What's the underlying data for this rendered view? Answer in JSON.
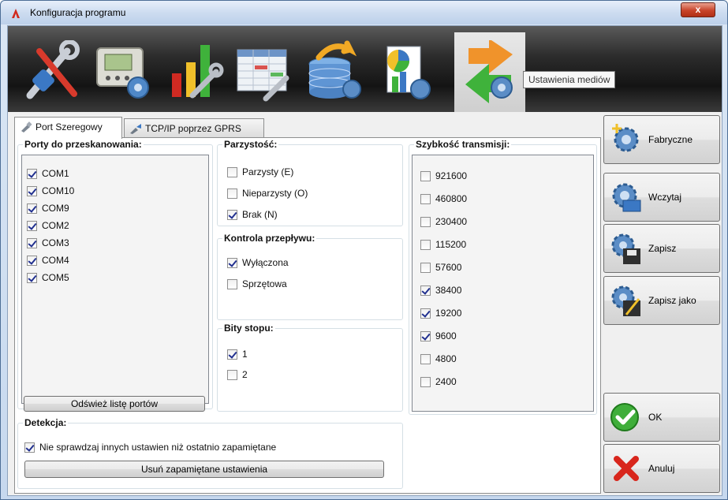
{
  "window": {
    "title": "Konfiguracja programu",
    "close_label": "x"
  },
  "toolbar": {
    "tooltip": "Ustawienia mediów",
    "tools": [
      "tools-icon",
      "device-config-icon",
      "chart-config-icon",
      "table-config-icon",
      "database-config-icon",
      "report-config-icon",
      "media-settings-icon"
    ]
  },
  "tabs": [
    {
      "label": "Port Szeregowy",
      "icon": "serial-port-icon"
    },
    {
      "label": "TCP/IP poprzez GPRS",
      "icon": "gprs-icon"
    }
  ],
  "ports": {
    "title": "Porty do przeskanowania:",
    "items": [
      {
        "label": "COM1",
        "checked": true
      },
      {
        "label": "COM10",
        "checked": true
      },
      {
        "label": "COM9",
        "checked": true
      },
      {
        "label": "COM2",
        "checked": true
      },
      {
        "label": "COM3",
        "checked": true
      },
      {
        "label": "COM4",
        "checked": true
      },
      {
        "label": "COM5",
        "checked": true
      }
    ],
    "refresh_label": "Odśwież listę portów"
  },
  "parity": {
    "title": "Parzystość:",
    "items": [
      {
        "label": "Parzysty (E)",
        "checked": false
      },
      {
        "label": "Nieparzysty (O)",
        "checked": false
      },
      {
        "label": "Brak (N)",
        "checked": true
      }
    ]
  },
  "flow": {
    "title": "Kontrola przepływu:",
    "items": [
      {
        "label": "Wyłączona",
        "checked": true
      },
      {
        "label": "Sprzętowa",
        "checked": false
      }
    ]
  },
  "stopbits": {
    "title": "Bity stopu:",
    "items": [
      {
        "label": "1",
        "checked": true
      },
      {
        "label": "2",
        "checked": false
      }
    ]
  },
  "baud": {
    "title": "Szybkość transmisji:",
    "items": [
      {
        "label": "921600",
        "checked": false
      },
      {
        "label": "460800",
        "checked": false
      },
      {
        "label": "230400",
        "checked": false
      },
      {
        "label": "115200",
        "checked": false
      },
      {
        "label": "57600",
        "checked": false
      },
      {
        "label": "38400",
        "checked": true
      },
      {
        "label": "19200",
        "checked": true
      },
      {
        "label": "9600",
        "checked": true
      },
      {
        "label": "4800",
        "checked": false
      },
      {
        "label": "2400",
        "checked": false
      }
    ]
  },
  "detection": {
    "title": "Detekcja:",
    "option_label": "Nie sprawdzaj innych ustawien niż ostatnio zapamiętane",
    "option_checked": true,
    "clear_label": "Usuń zapamiętane ustawienia"
  },
  "side_buttons": {
    "factory": "Fabryczne",
    "load": "Wczytaj",
    "save": "Zapisz",
    "save_as": "Zapisz jako",
    "ok": "OK",
    "cancel": "Anuluj"
  }
}
